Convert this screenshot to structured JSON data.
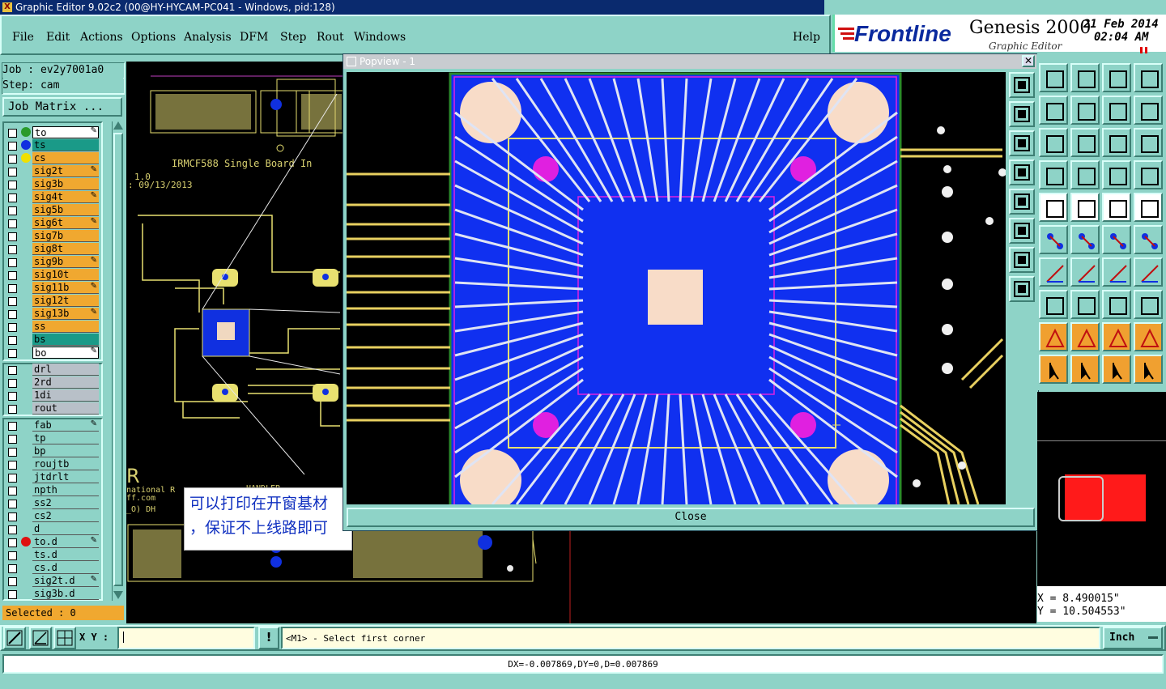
{
  "window": {
    "title": "Graphic Editor 9.02c2 (00@HY-HYCAM-PC041 - Windows, pid:128)"
  },
  "menu": {
    "items": [
      "File",
      "Edit",
      "Actions",
      "Options",
      "Analysis",
      "DFM",
      "Step",
      "Rout",
      "Windows"
    ],
    "help": "Help"
  },
  "brand": {
    "name": "Frontline",
    "product": "Genesis 2000",
    "subtitle": "Graphic Editor",
    "date": "21 Feb 2014",
    "time": "02:04 AM"
  },
  "job": {
    "job_label": "Job : ev2y7001a0",
    "step_label": "Step: cam",
    "matrix_button": "Job Matrix ..."
  },
  "layers": {
    "board": [
      {
        "name": "to",
        "color": "#ffffff",
        "dot": "#2a9a2a",
        "pen": true
      },
      {
        "name": "ts",
        "color": "#1a9a88",
        "dot": "#1030e0",
        "pen": false
      },
      {
        "name": "cs",
        "color": "#f0a830",
        "dot": "#f0e000",
        "pen": false
      },
      {
        "name": "sig2t",
        "color": "#f0a830",
        "dot": "",
        "pen": true
      },
      {
        "name": "sig3b",
        "color": "#f0a830",
        "dot": "",
        "pen": false
      },
      {
        "name": "sig4t",
        "color": "#f0a830",
        "dot": "",
        "pen": true
      },
      {
        "name": "sig5b",
        "color": "#f0a830",
        "dot": "",
        "pen": false
      },
      {
        "name": "sig6t",
        "color": "#f0a830",
        "dot": "",
        "pen": true
      },
      {
        "name": "sig7b",
        "color": "#f0a830",
        "dot": "",
        "pen": false
      },
      {
        "name": "sig8t",
        "color": "#f0a830",
        "dot": "",
        "pen": false
      },
      {
        "name": "sig9b",
        "color": "#f0a830",
        "dot": "",
        "pen": true
      },
      {
        "name": "sig10t",
        "color": "#f0a830",
        "dot": "",
        "pen": false
      },
      {
        "name": "sig11b",
        "color": "#f0a830",
        "dot": "",
        "pen": true
      },
      {
        "name": "sig12t",
        "color": "#f0a830",
        "dot": "",
        "pen": false
      },
      {
        "name": "sig13b",
        "color": "#f0a830",
        "dot": "",
        "pen": true
      },
      {
        "name": "ss",
        "color": "#f0a830",
        "dot": "",
        "pen": false
      },
      {
        "name": "bs",
        "color": "#1a9a88",
        "dot": "",
        "pen": false
      },
      {
        "name": "bo",
        "color": "#ffffff",
        "dot": "",
        "pen": true
      }
    ],
    "drill": [
      {
        "name": "drl",
        "color": "#b8c0c8"
      },
      {
        "name": "2rd",
        "color": "#b8c0c8"
      },
      {
        "name": "1di",
        "color": "#b8c0c8"
      },
      {
        "name": "rout",
        "color": "#b8c0c8"
      }
    ],
    "misc": [
      {
        "name": "fab",
        "pen": true
      },
      {
        "name": "tp",
        "pen": false
      },
      {
        "name": "bp",
        "pen": false
      },
      {
        "name": "roujtb",
        "pen": false
      },
      {
        "name": "jtdrlt",
        "pen": false
      },
      {
        "name": "npth",
        "pen": false
      },
      {
        "name": "ss2",
        "pen": false
      },
      {
        "name": "cs2",
        "pen": false
      },
      {
        "name": "d",
        "pen": false
      },
      {
        "name": "to.d",
        "pen": true
      },
      {
        "name": "ts.d",
        "pen": false
      },
      {
        "name": "cs.d",
        "pen": false
      },
      {
        "name": "sig2t.d",
        "pen": true
      },
      {
        "name": "sig3b.d",
        "pen": false
      }
    ],
    "selected_label": "Selected : 0"
  },
  "canvas": {
    "board_text": "IRMCF588 Single Board In",
    "rev_text": "1.0",
    "date_text": ": 09/13/2013",
    "handler_text": "HANDLER",
    "company_text": "national R",
    "dh_text": "_O) DH",
    "url_text": "ff.com",
    "annotation_line1": "可以打印在开窗基材",
    "annotation_line2": "，保证不上线路即可"
  },
  "popview": {
    "title": "Popview - 1",
    "close_button": "Close"
  },
  "coords": {
    "x": "X = 8.490015\"",
    "y": "Y = 10.504553\""
  },
  "status": {
    "xy_label": "X Y :",
    "xy_value": "",
    "prompt": "<M1> - Select first corner",
    "units": "Inch"
  },
  "dx_text": "DX=-0.007869,DY=0,D=0.007869"
}
